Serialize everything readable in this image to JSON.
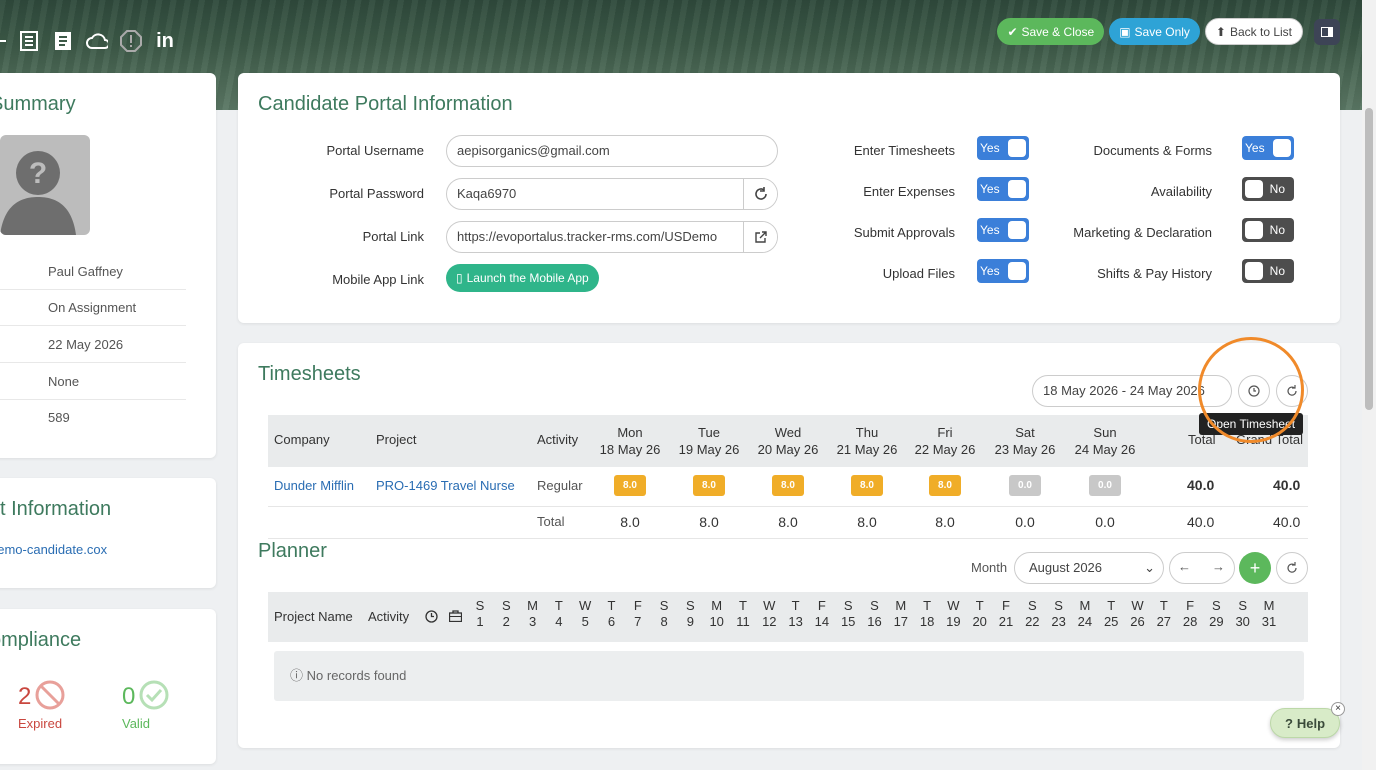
{
  "header": {
    "buttons": {
      "save_close": "Save & Close",
      "save_only": "Save Only",
      "back": "Back to List"
    },
    "icons": [
      "list-icon",
      "document-icon",
      "cloud-icon",
      "warning-icon",
      "linkedin-icon"
    ]
  },
  "summary": {
    "title": "Summary",
    "rows": [
      "Paul Gaffney",
      "On Assignment",
      "22 May 2026",
      "None",
      "589"
    ]
  },
  "contact": {
    "title": "ct Information",
    "email": "demo-candidate.cox"
  },
  "compliance": {
    "title": "ompliance",
    "expired_count": "2",
    "expired_label": "Expired",
    "valid_count": "0",
    "valid_label": "Valid"
  },
  "portal": {
    "title": "Candidate Portal Information",
    "username_label": "Portal Username",
    "username": "aepisorganics@gmail.com",
    "password_label": "Portal Password",
    "password": "Kaqa6970",
    "link_label": "Portal Link",
    "link": "https://evoportalus.tracker-rms.com/USDemo",
    "mobile_label": "Mobile App Link",
    "mobile_btn": "Launch the Mobile App",
    "toggles_left": [
      {
        "label": "Enter Timesheets",
        "state": "Yes"
      },
      {
        "label": "Enter Expenses",
        "state": "Yes"
      },
      {
        "label": "Submit Approvals",
        "state": "Yes"
      },
      {
        "label": "Upload Files",
        "state": "Yes"
      }
    ],
    "toggles_right": [
      {
        "label": "Documents & Forms",
        "state": "Yes"
      },
      {
        "label": "Availability",
        "state": "No"
      },
      {
        "label": "Marketing & Declaration",
        "state": "No"
      },
      {
        "label": "Shifts & Pay History",
        "state": "No"
      }
    ]
  },
  "timesheets": {
    "title": "Timesheets",
    "range": "18 May 2026 - 24 May 2026",
    "tooltip": "Open Timesheet",
    "headers": {
      "company": "Company",
      "project": "Project",
      "activity": "Activity",
      "total": "Total",
      "grand_total": "Grand Total"
    },
    "days": [
      {
        "d": "Mon",
        "dt": "18 May 26"
      },
      {
        "d": "Tue",
        "dt": "19 May 26"
      },
      {
        "d": "Wed",
        "dt": "20 May 26"
      },
      {
        "d": "Thu",
        "dt": "21 May 26"
      },
      {
        "d": "Fri",
        "dt": "22 May 26"
      },
      {
        "d": "Sat",
        "dt": "23 May 26"
      },
      {
        "d": "Sun",
        "dt": "24 May 26"
      }
    ],
    "row": {
      "company": "Dunder Mifflin",
      "project": "PRO-1469 Travel Nurse",
      "activity": "Regular",
      "values": [
        "8.0",
        "8.0",
        "8.0",
        "8.0",
        "8.0",
        "0.0",
        "0.0"
      ],
      "total": "40.0",
      "grand_total": "40.0"
    },
    "totals": {
      "label": "Total",
      "values": [
        "8.0",
        "8.0",
        "8.0",
        "8.0",
        "8.0",
        "0.0",
        "0.0"
      ],
      "total": "40.0",
      "grand_total": "40.0"
    }
  },
  "planner": {
    "title": "Planner",
    "month_label": "Month",
    "month": "August 2026",
    "headers": {
      "project": "Project Name",
      "activity": "Activity"
    },
    "days": [
      [
        "S",
        "1"
      ],
      [
        "S",
        "2"
      ],
      [
        "M",
        "3"
      ],
      [
        "T",
        "4"
      ],
      [
        "W",
        "5"
      ],
      [
        "T",
        "6"
      ],
      [
        "F",
        "7"
      ],
      [
        "S",
        "8"
      ],
      [
        "S",
        "9"
      ],
      [
        "M",
        "10"
      ],
      [
        "T",
        "11"
      ],
      [
        "W",
        "12"
      ],
      [
        "T",
        "13"
      ],
      [
        "F",
        "14"
      ],
      [
        "S",
        "15"
      ],
      [
        "S",
        "16"
      ],
      [
        "M",
        "17"
      ],
      [
        "T",
        "18"
      ],
      [
        "W",
        "19"
      ],
      [
        "T",
        "20"
      ],
      [
        "F",
        "21"
      ],
      [
        "S",
        "22"
      ],
      [
        "S",
        "23"
      ],
      [
        "M",
        "24"
      ],
      [
        "T",
        "25"
      ],
      [
        "W",
        "26"
      ],
      [
        "T",
        "27"
      ],
      [
        "F",
        "28"
      ],
      [
        "S",
        "29"
      ],
      [
        "S",
        "30"
      ],
      [
        "M",
        "31"
      ]
    ],
    "empty": "No records found"
  },
  "help": "Help",
  "colors": {
    "accent": "#3e7a5e",
    "blue": "#3b7fd9",
    "orange": "#f08a2a"
  }
}
